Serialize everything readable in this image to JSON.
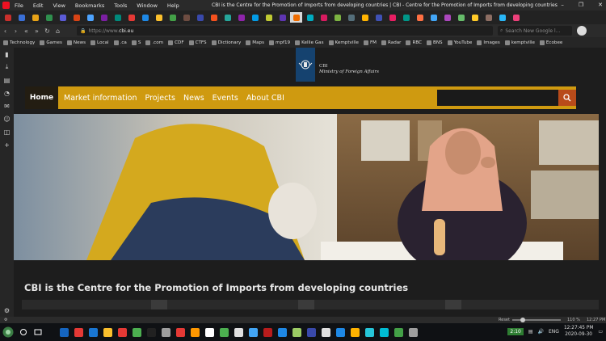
{
  "window": {
    "menu": [
      "File",
      "Edit",
      "View",
      "Bookmarks",
      "Tools",
      "Window",
      "Help"
    ],
    "title": "CBI is the Centre for the Promotion of Imports from developing countries | CBI - Centre for the Promotion of Imports from developing countries"
  },
  "tab_favicon_colors": [
    "#c9302c",
    "#3a6fd6",
    "#e8a317",
    "#2f8f4e",
    "#5b5bd6",
    "#d84315",
    "#4da3ff",
    "#7b1fa2",
    "#00897b",
    "#e53935",
    "#1e88e5",
    "#fbc02d",
    "#43a047",
    "#6d4c41",
    "#3949ab",
    "#f4511e",
    "#26a69a",
    "#8e24aa",
    "#039be5",
    "#c0ca33",
    "#5e35b1",
    "#ef6c00",
    "#00acc1",
    "#d81b60",
    "#7cb342",
    "#546e7a",
    "#ffb300",
    "#3f51b5",
    "#e91e63",
    "#009688",
    "#ff7043",
    "#42a5f5",
    "#ab47bc",
    "#66bb6a",
    "#ffca28",
    "#8d6e63",
    "#29b6f6",
    "#ec407a"
  ],
  "address": {
    "url_prefix": "https://www.",
    "url_domain": "cbi.eu",
    "search_placeholder": "Search New Google l..."
  },
  "bookmarks": [
    "Technology",
    "Games",
    "News",
    "Local",
    ".ca",
    "S",
    ".com",
    "CDF",
    "CTFS",
    "Dictionary",
    "Maps",
    "mpf19",
    "Kellie Gas",
    "Kemptville",
    "FM",
    "Radar",
    "RBC",
    "BNS",
    "YouTube",
    "Images",
    "kemptville",
    "Ecobee"
  ],
  "sidepanel_icons": [
    "bookmark-panel-icon",
    "download-panel-icon",
    "notes-panel-icon",
    "history-panel-icon",
    "mail-panel-icon",
    "contacts-panel-icon",
    "window-panel-icon",
    "add-panel-icon"
  ],
  "ministry": {
    "abbr": "CBI",
    "name": "Ministry of Foreign Affairs"
  },
  "nav": {
    "home": "Home",
    "items": [
      "Market information",
      "Projects",
      "News",
      "Events",
      "About CBI"
    ]
  },
  "headline": "CBI is the Centre for the Promotion of Imports from developing countries",
  "statusbar": {
    "reset": "Reset",
    "zoom": "110 %",
    "time": "12:27 PM"
  },
  "taskbar": {
    "app_colors": [
      "#1565c0",
      "#e53935",
      "#1976d2",
      "#fbc02d",
      "#e53935",
      "#4caf50",
      "#212121",
      "#9e9e9e",
      "#e53935",
      "#ff9800",
      "#ffffff",
      "#4caf50",
      "#e0e0e0",
      "#42a5f5",
      "#b71c1c",
      "#1e88e5",
      "#9ccc65",
      "#3949ab",
      "#e0e0e0",
      "#1e88e5",
      "#ffb300",
      "#26c6da",
      "#00bcd4",
      "#43a047",
      "#9e9e9e"
    ],
    "badge": "2:10",
    "language": "ENG",
    "clock_time": "12:27:45 PM",
    "clock_date": "2020-09-30"
  }
}
